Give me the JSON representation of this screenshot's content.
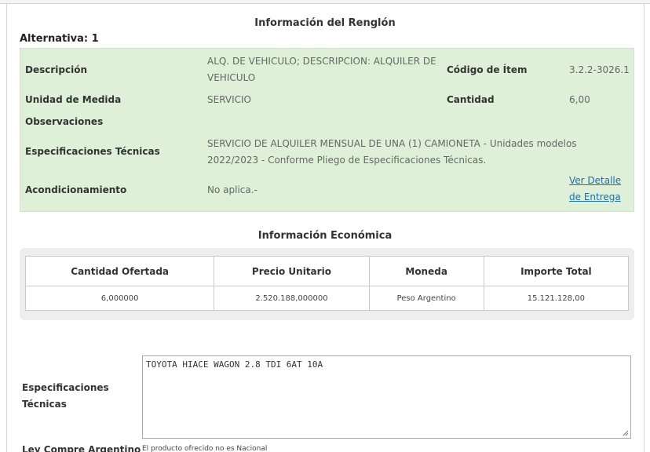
{
  "renglon": {
    "title": "Información del Renglón",
    "alternativa": "Alternativa: 1",
    "rows": {
      "descripcion_label": "Descripción",
      "descripcion_value_line1": "ALQ. DE VEHICULO; DESCRIPCION: ALQUILER DE",
      "descripcion_value_line2": "VEHICULO",
      "codigo_label": "Código de Ítem",
      "codigo_value": "3.2.2-3026.1",
      "unidad_label": "Unidad de Medida",
      "unidad_value": "SERVICIO",
      "cantidad_label": "Cantidad",
      "cantidad_value": "6,00",
      "observaciones_label": "Observaciones",
      "especificaciones_label": "Especificaciones Técnicas",
      "especificaciones_value_line1": "SERVICIO DE ALQUILER MENSUAL DE UNA (1) CAMIONETA - Unidades modelos",
      "especificaciones_value_line2": "2022/2023 - Conforme Pliego de Especificaciones Técnicas.",
      "acondicionamiento_label": "Acondicionamiento",
      "acondicionamiento_value": "No aplica.-",
      "ver_detalle_line1": "Ver Detalle",
      "ver_detalle_line2": "de Entrega"
    }
  },
  "economica": {
    "title": "Información Económica",
    "headers": [
      "Cantidad Ofertada",
      "Precio Unitario",
      "Moneda",
      "Importe Total"
    ],
    "row": [
      "6,000000",
      "2.520.188,000000",
      "Peso Argentino",
      "15.121.128,00"
    ]
  },
  "oferta": {
    "spec_label_line1": "Especificaciones",
    "spec_label_line2": "Técnicas",
    "spec_value": "TOYOTA HIACE WAGON 2.8 TDI 6AT 10A",
    "ley_label": "Ley Compre Argentino",
    "ley_value": "El producto ofrecido no es Nacional"
  },
  "colors": {
    "detail_bg": "#dff0d8",
    "link": "#1a6fb0",
    "table_wrap_bg": "#eeeeee"
  }
}
